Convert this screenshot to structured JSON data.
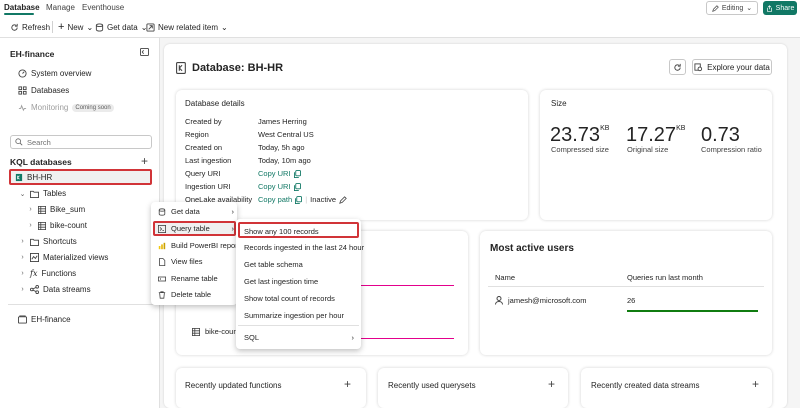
{
  "tabs": [
    {
      "label": "Database"
    },
    {
      "label": "Manage"
    },
    {
      "label": "Eventhouse"
    }
  ],
  "header": {
    "editing_label": "Editing",
    "share_label": "Share"
  },
  "toolbar": {
    "refresh": "Refresh",
    "new": "New",
    "get_data": "Get data",
    "new_related_item": "New related item"
  },
  "sidebar": {
    "title": "EH-finance",
    "nav": [
      {
        "label": "System overview"
      },
      {
        "label": "Databases"
      },
      {
        "label": "Monitoring",
        "badge": "Coming soon"
      }
    ],
    "search_placeholder": "Search",
    "kql_section": "KQL databases",
    "tree": {
      "database": "BH-HR",
      "tables": "Tables",
      "table_items": [
        "Bike_sum",
        "bike-count"
      ],
      "shortcuts": "Shortcuts",
      "materialized_views": "Materialized views",
      "functions": "Functions",
      "data_streams": "Data streams"
    },
    "eventhouse": "EH-finance"
  },
  "main": {
    "title": "Database: BH-HR",
    "explore_label": "Explore your data",
    "details": {
      "title": "Database details",
      "rows": [
        {
          "label": "Created by",
          "value": "James Herring"
        },
        {
          "label": "Region",
          "value": "West Central US"
        },
        {
          "label": "Created on",
          "value": "Today, 5h ago"
        },
        {
          "label": "Last ingestion",
          "value": "Today, 10m ago"
        },
        {
          "label": "Query URI",
          "value": "Copy URI"
        },
        {
          "label": "Ingestion URI",
          "value": "Copy URI"
        },
        {
          "label": "OneLake availability",
          "value": "Copy path",
          "status": "Inactive"
        }
      ]
    },
    "size": {
      "title": "Size",
      "metrics": [
        {
          "value": "23.73",
          "unit": "KB",
          "label": "Compressed size"
        },
        {
          "value": "17.27",
          "unit": "KB",
          "label": "Original size"
        },
        {
          "value": "0.73",
          "unit": "",
          "label": "Compression ratio"
        }
      ]
    },
    "bike_count_label": "bike-count",
    "active_users": {
      "title": "Most active users",
      "col_name": "Name",
      "col_queries": "Queries run last month",
      "rows": [
        {
          "name": "jamesh@microsoft.com",
          "queries": "26"
        }
      ]
    },
    "bottom_cards": [
      {
        "title": "Recently updated functions"
      },
      {
        "title": "Recently used querysets"
      },
      {
        "title": "Recently created data streams"
      }
    ]
  },
  "context_menu": {
    "items": [
      {
        "label": "Get data"
      },
      {
        "label": "Query table"
      },
      {
        "label": "Build PowerBI report"
      },
      {
        "label": "View files"
      },
      {
        "label": "Rename table"
      },
      {
        "label": "Delete table"
      }
    ]
  },
  "submenu": {
    "items": [
      {
        "label": "Show any 100 records"
      },
      {
        "label": "Records ingested in the last 24 hour"
      },
      {
        "label": "Get table schema"
      },
      {
        "label": "Get last ingestion time"
      },
      {
        "label": "Show total count of records"
      },
      {
        "label": "Summarize ingestion per hour"
      },
      {
        "label": "SQL"
      }
    ]
  },
  "colors": {
    "accent": "#117865",
    "highlight": "#d13438",
    "line_pink": "#e3008c",
    "line_green": "#107c10"
  }
}
